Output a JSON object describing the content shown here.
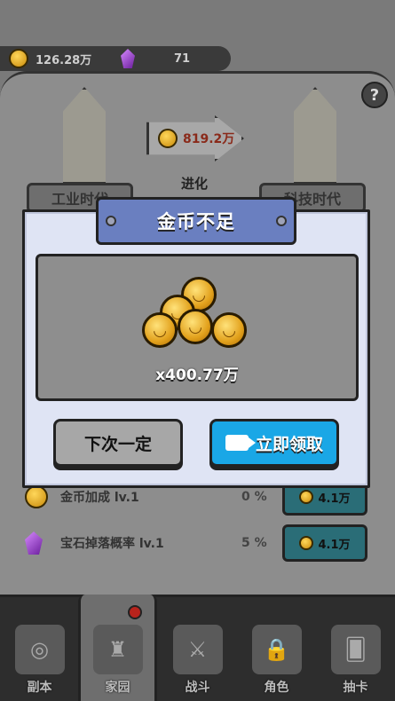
{
  "resources": {
    "coins": "126.28万",
    "gems": "71"
  },
  "help_label": "?",
  "evolve": {
    "cost": "819.2万",
    "label": "进化"
  },
  "eras": {
    "left": "工业时代",
    "right": "科技时代"
  },
  "upgrades": [
    {
      "name": "金币加成 lv.1",
      "percent": "0 %",
      "cost": "4.1万"
    },
    {
      "name": "宝石掉落概率 lv.1",
      "percent": "5 %",
      "cost": "4.1万"
    }
  ],
  "modal": {
    "title": "金币不足",
    "amount": "x400.77万",
    "cancel_label": "下次一定",
    "claim_label": "立即领取"
  },
  "nav": [
    {
      "label": "副本"
    },
    {
      "label": "家园"
    },
    {
      "label": "战斗"
    },
    {
      "label": "角色"
    },
    {
      "label": "抽卡"
    }
  ],
  "colors": {
    "modal_title": "#6a7fc0",
    "claim_button": "#1aa7e6",
    "cancel_button": "#a7a7a7"
  }
}
